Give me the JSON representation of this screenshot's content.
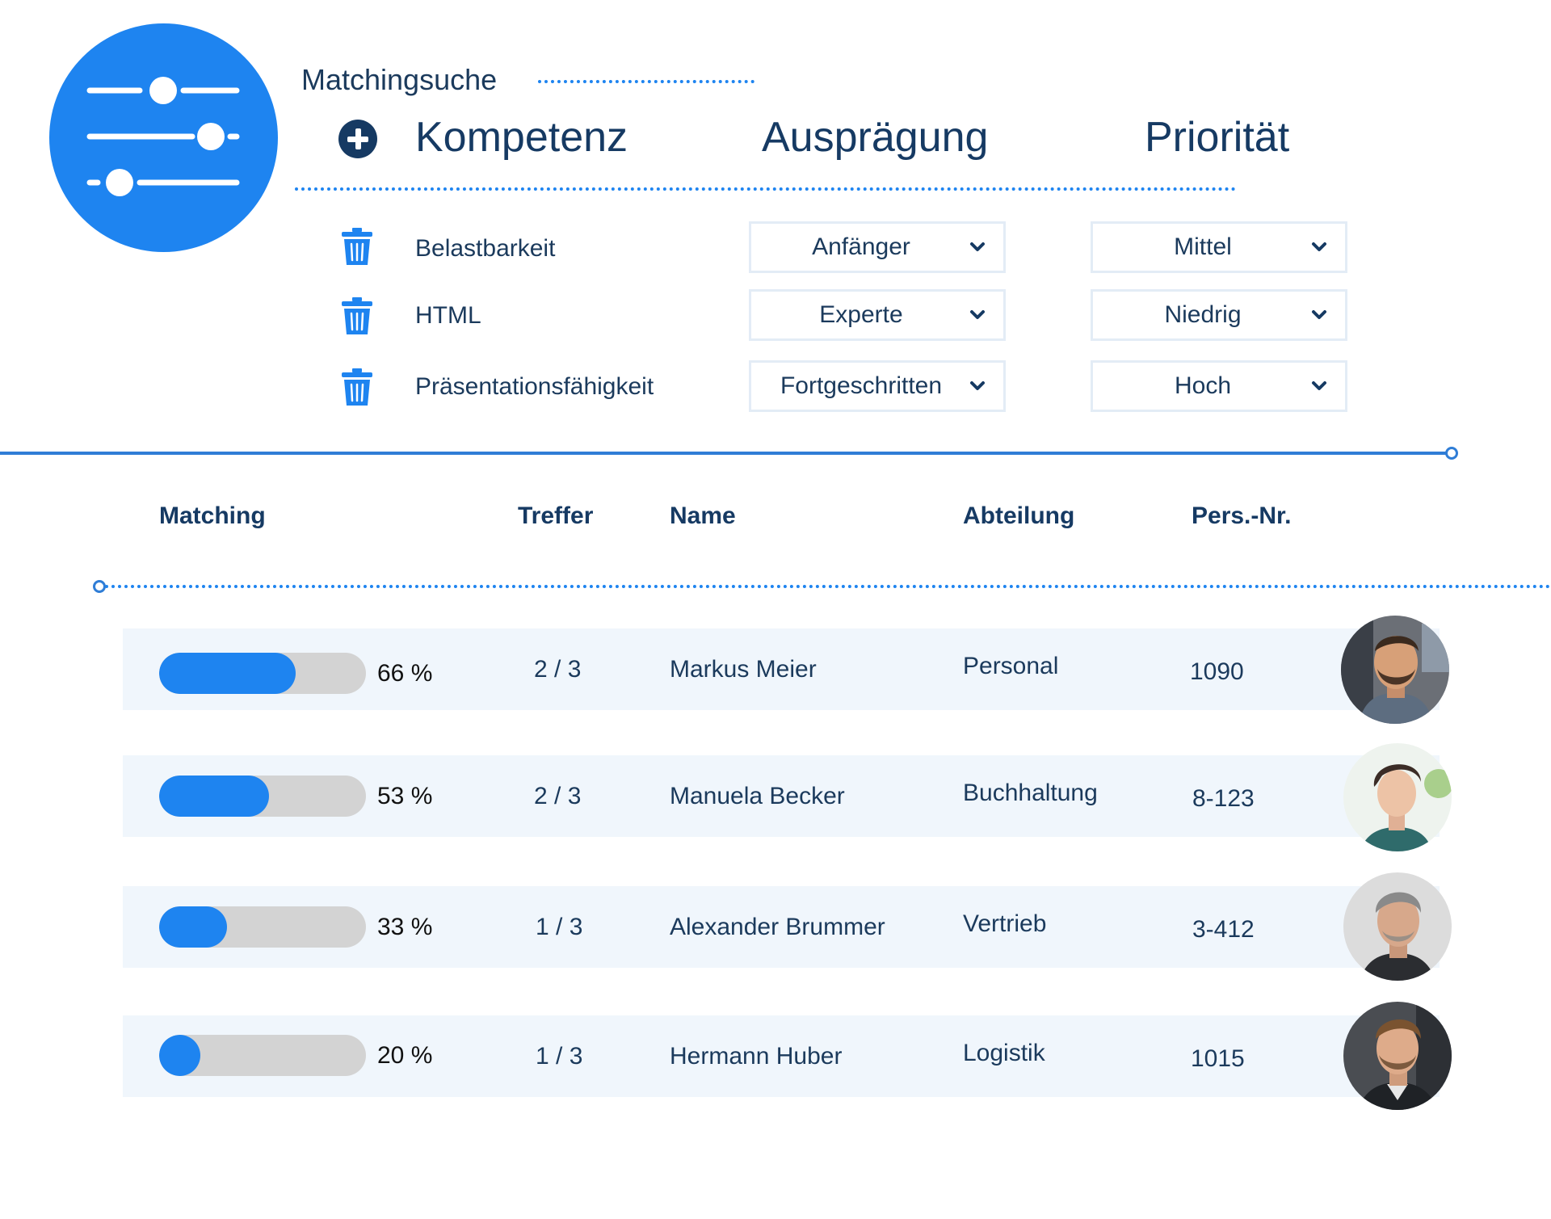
{
  "header": {
    "subtitle": "Matchingsuche",
    "columns": {
      "kompetenz": "Kompetenz",
      "auspraegung": "Ausprägung",
      "prioritaet": "Priorität"
    }
  },
  "icons": {
    "logo": "sliders-icon",
    "add": "plus-circle-icon",
    "delete": "trash-icon",
    "dropdown": "chevron-down-icon"
  },
  "colors": {
    "accent": "#1e84f0",
    "dark_navy": "#163a63",
    "bar_track": "#d3d3d3",
    "row_bg": "#f0f6fc"
  },
  "skills": [
    {
      "name": "Belastbarkeit",
      "level": "Anfänger",
      "priority": "Mittel"
    },
    {
      "name": "HTML",
      "level": "Experte",
      "priority": "Niedrig"
    },
    {
      "name": "Präsentationsfähigkeit",
      "level": "Fortgeschritten",
      "priority": "Hoch"
    }
  ],
  "results": {
    "headers": {
      "matching": "Matching",
      "treffer": "Treffer",
      "name": "Name",
      "abteilung": "Abteilung",
      "persnr": "Pers.-Nr."
    },
    "rows": [
      {
        "match_fraction": 0.66,
        "match_label": "66 %",
        "hits": "2 / 3",
        "name": "Markus Meier",
        "department": "Personal",
        "personnel_no": "1090"
      },
      {
        "match_fraction": 0.53,
        "match_label": "53 %",
        "hits": "2 / 3",
        "name": "Manuela Becker",
        "department": "Buchhaltung",
        "personnel_no": "8-123"
      },
      {
        "match_fraction": 0.33,
        "match_label": "33 %",
        "hits": "1 / 3",
        "name": "Alexander Brummer",
        "department": "Vertrieb",
        "personnel_no": "3-412"
      },
      {
        "match_fraction": 0.2,
        "match_label": "20 %",
        "hits": "1 / 3",
        "name": "Hermann Huber",
        "department": "Logistik",
        "personnel_no": "1015"
      }
    ]
  }
}
